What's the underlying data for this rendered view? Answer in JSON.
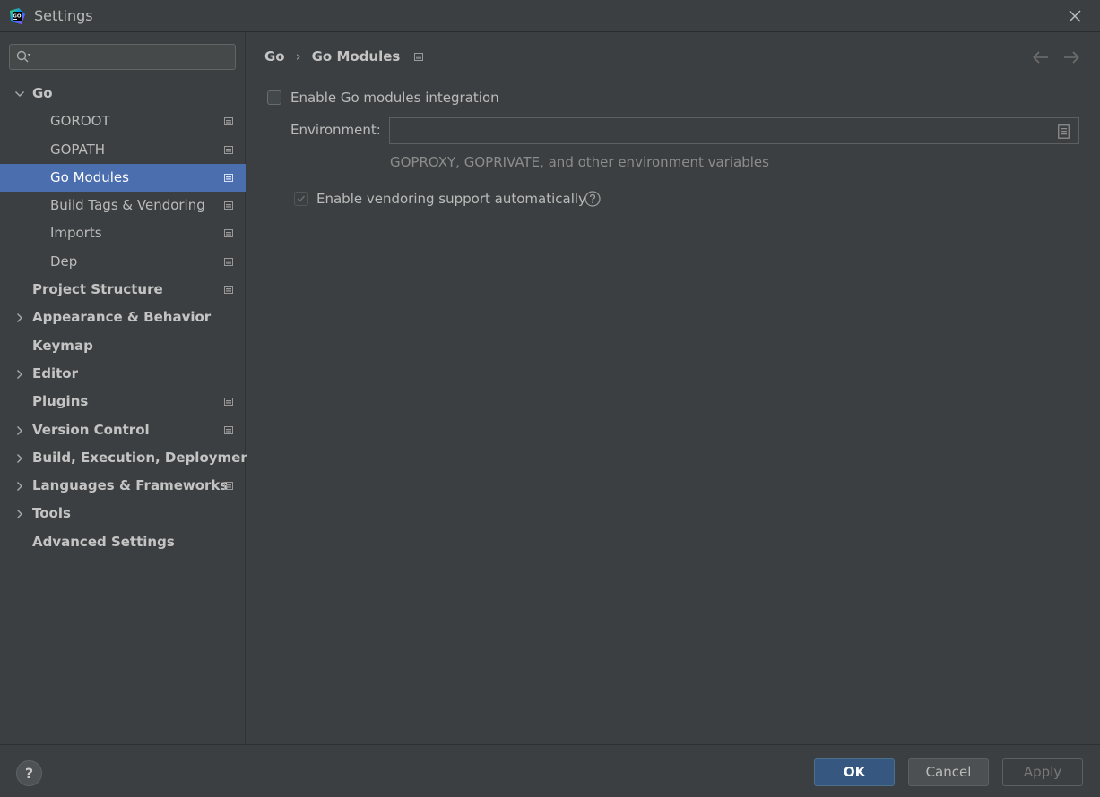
{
  "window": {
    "title": "Settings"
  },
  "search": {
    "placeholder": "",
    "value": ""
  },
  "tree": [
    {
      "label": "Go",
      "level": 0,
      "expand": "open",
      "project": false,
      "selected": false
    },
    {
      "label": "GOROOT",
      "level": 1,
      "expand": "none",
      "project": true,
      "selected": false
    },
    {
      "label": "GOPATH",
      "level": 1,
      "expand": "none",
      "project": true,
      "selected": false
    },
    {
      "label": "Go Modules",
      "level": 1,
      "expand": "none",
      "project": true,
      "selected": true
    },
    {
      "label": "Build Tags & Vendoring",
      "level": 1,
      "expand": "none",
      "project": true,
      "selected": false
    },
    {
      "label": "Imports",
      "level": 1,
      "expand": "none",
      "project": true,
      "selected": false
    },
    {
      "label": "Dep",
      "level": 1,
      "expand": "none",
      "project": true,
      "selected": false
    },
    {
      "label": "Project Structure",
      "level": 0,
      "expand": "none",
      "project": true,
      "selected": false
    },
    {
      "label": "Appearance & Behavior",
      "level": 0,
      "expand": "closed",
      "project": false,
      "selected": false
    },
    {
      "label": "Keymap",
      "level": 0,
      "expand": "none",
      "project": false,
      "selected": false
    },
    {
      "label": "Editor",
      "level": 0,
      "expand": "closed",
      "project": false,
      "selected": false
    },
    {
      "label": "Plugins",
      "level": 0,
      "expand": "none",
      "project": true,
      "selected": false
    },
    {
      "label": "Version Control",
      "level": 0,
      "expand": "closed",
      "project": true,
      "selected": false
    },
    {
      "label": "Build, Execution, Deployment",
      "level": 0,
      "expand": "closed",
      "project": false,
      "selected": false
    },
    {
      "label": "Languages & Frameworks",
      "level": 0,
      "expand": "closed",
      "project": true,
      "selected": false
    },
    {
      "label": "Tools",
      "level": 0,
      "expand": "closed",
      "project": false,
      "selected": false
    },
    {
      "label": "Advanced Settings",
      "level": 0,
      "expand": "none",
      "project": false,
      "selected": false
    }
  ],
  "breadcrumb": {
    "parent": "Go",
    "separator": "›",
    "current": "Go Modules"
  },
  "form": {
    "enable_modules_label": "Enable Go modules integration",
    "enable_modules_checked": false,
    "environment_label": "Environment:",
    "environment_value": "",
    "environment_hint": "GOPROXY, GOPRIVATE, and other environment variables",
    "vendoring_label": "Enable vendoring support automatically",
    "vendoring_checked": true,
    "vendoring_enabled": false
  },
  "footer": {
    "help": "?",
    "ok": "OK",
    "cancel": "Cancel",
    "apply": "Apply"
  },
  "colors": {
    "selection": "#4b6eaf",
    "ok_button": "#365880",
    "background": "#3c3f41"
  },
  "icons": [
    "go-app-icon",
    "close-icon",
    "search-icon",
    "chevron-down-icon",
    "chevron-right-icon",
    "project-settings-icon",
    "back-arrow-icon",
    "forward-arrow-icon",
    "browse-icon",
    "help-icon"
  ]
}
